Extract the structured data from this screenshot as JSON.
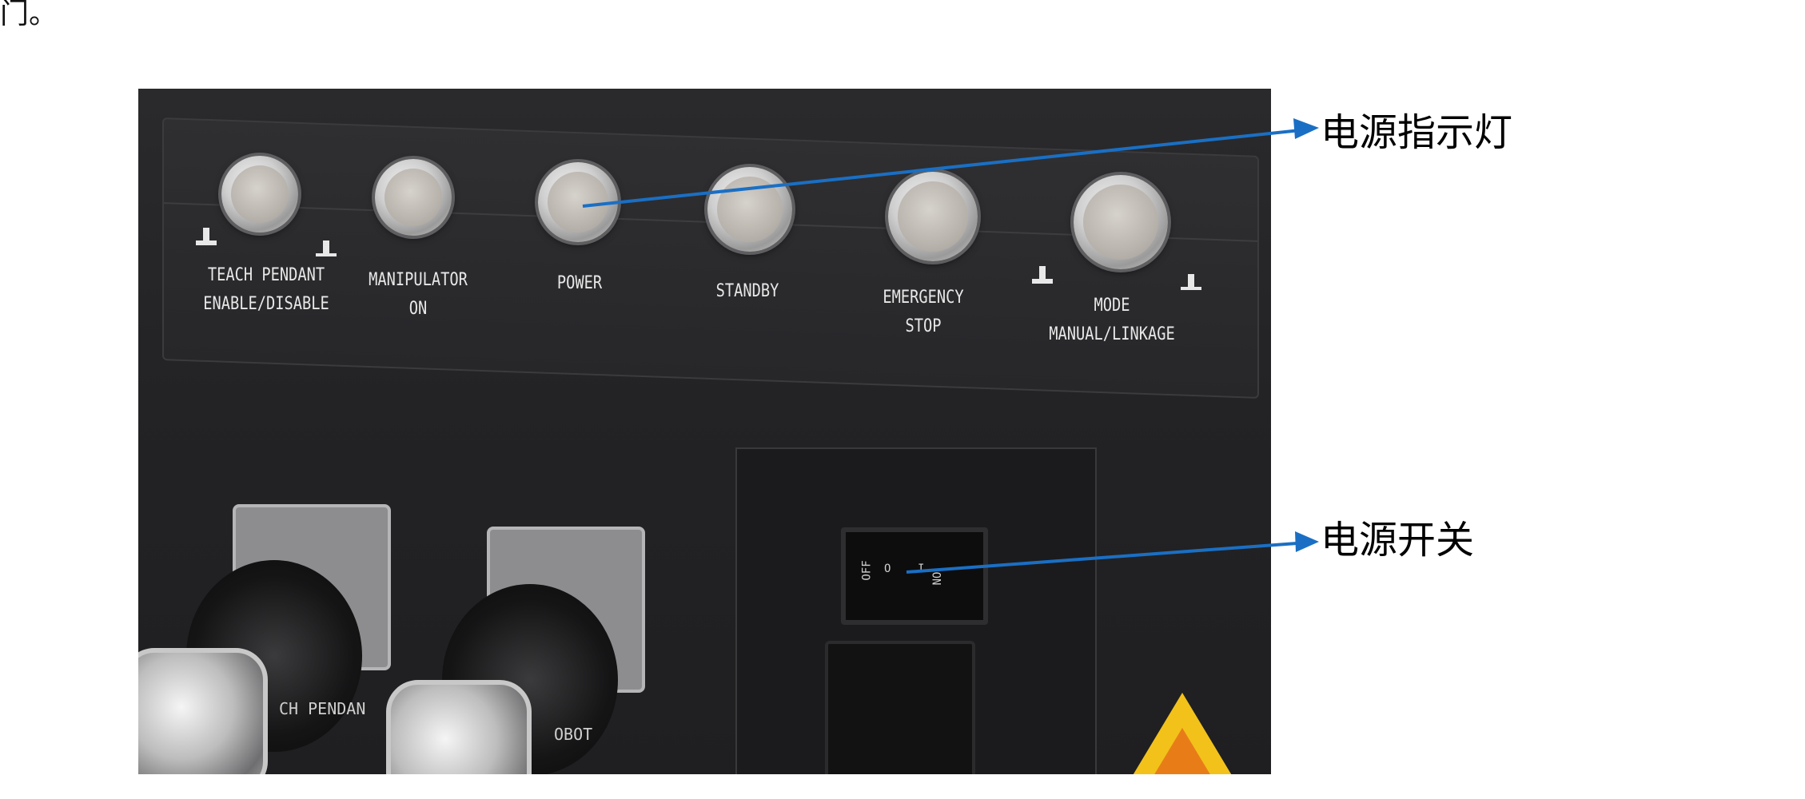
{
  "page": {
    "top_fragment": "门。"
  },
  "photo": {
    "buttons": [
      {
        "id": "teach-pendant",
        "lines": [
          "TEACH PENDANT",
          "ENABLE/DISABLE"
        ]
      },
      {
        "id": "manipulator-on",
        "lines": [
          "MANIPULATOR",
          "ON"
        ]
      },
      {
        "id": "power",
        "lines": [
          "POWER"
        ]
      },
      {
        "id": "standby",
        "lines": [
          "STANDBY"
        ]
      },
      {
        "id": "emergency-stop",
        "lines": [
          "EMERGENCY",
          "STOP"
        ]
      },
      {
        "id": "mode",
        "lines": [
          "MODE",
          "MANUAL/LINKAGE"
        ]
      }
    ],
    "switch": {
      "off_label": "OFF",
      "off_symbol": "O",
      "on_label": "ON",
      "on_symbol": "I"
    },
    "connectors": {
      "left_label": "CH PENDAN",
      "right_label": "OBOT"
    }
  },
  "annotations": {
    "power_indicator": "电源指示灯",
    "power_switch": "电源开关",
    "arrow_color": "#1a6fc4"
  }
}
